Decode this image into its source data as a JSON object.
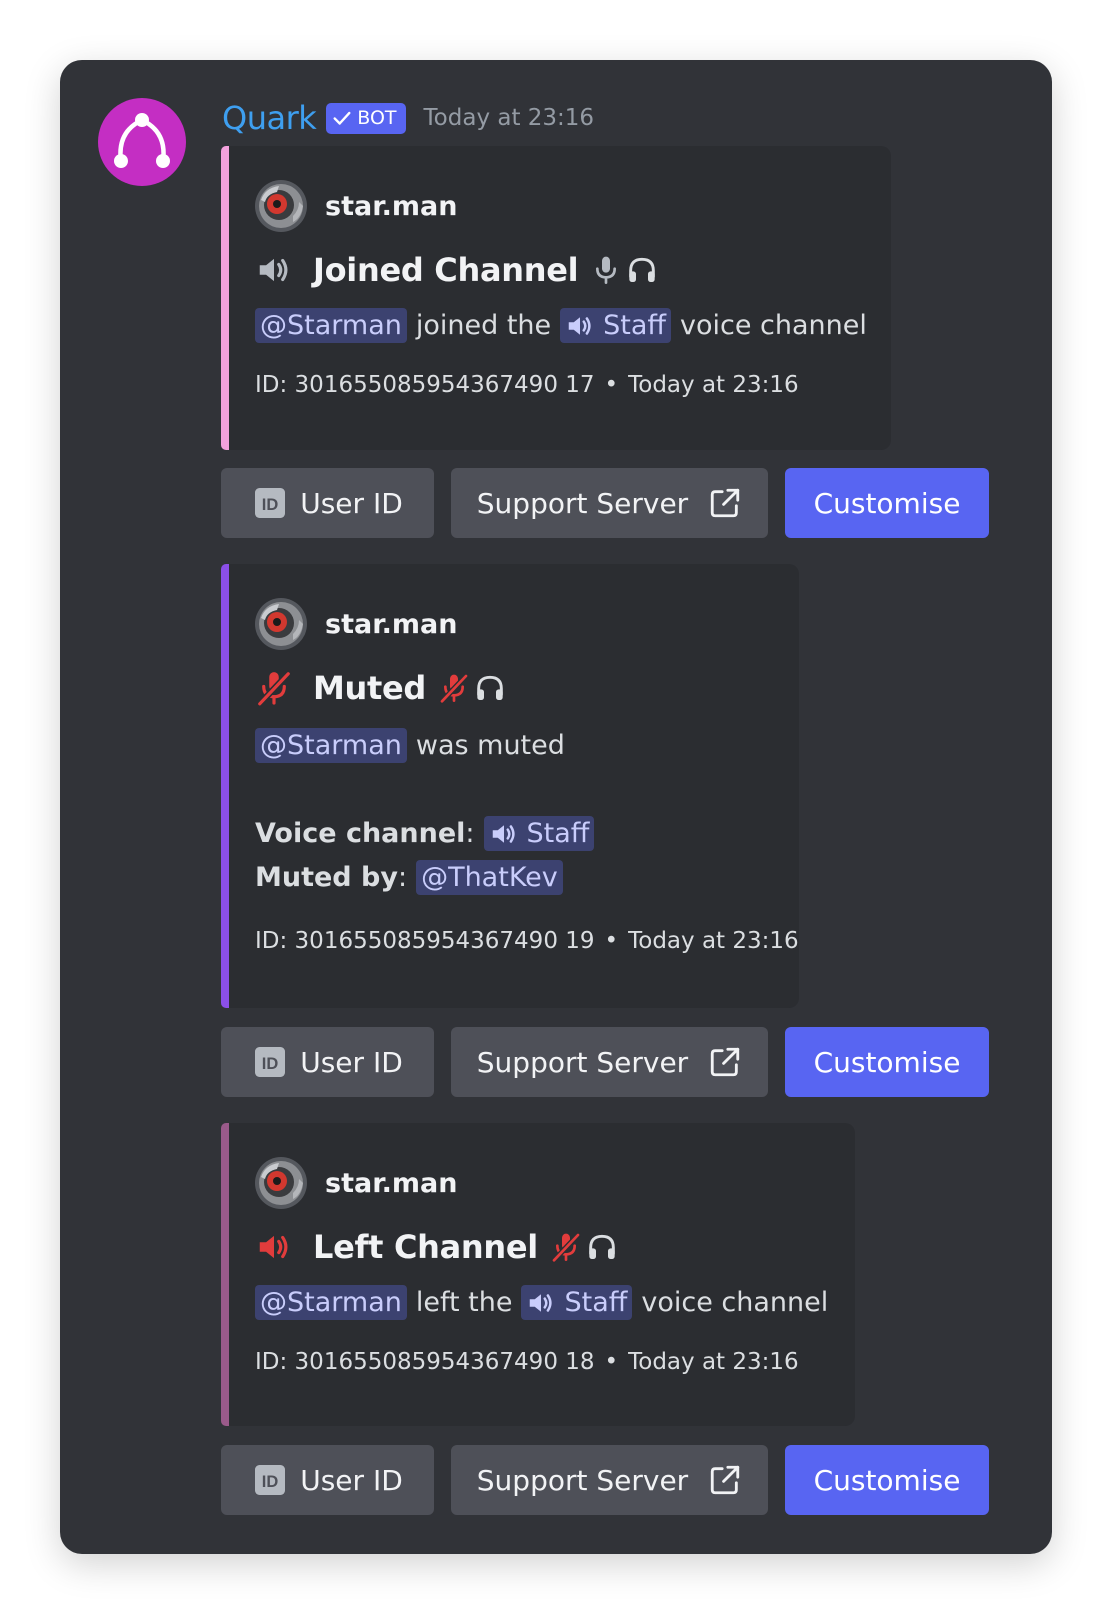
{
  "message": {
    "username": "Quark",
    "bot_tag": "BOT",
    "timestamp": "Today at 23:16",
    "avatar_icon": "quark-logo-icon",
    "colors": {
      "username": "#3e9ff0",
      "bot_tag": "#5865f2",
      "avatar": "#c42ec3"
    }
  },
  "embeds": [
    {
      "author": "star.man",
      "title": "Joined Channel",
      "lead_icon": "speaker-icon",
      "status_icons": [
        "microphone-icon",
        "headphones-icon"
      ],
      "user_mention": "@Starman",
      "text_1": "joined the",
      "channel_mention": "Staff",
      "text_2": "voice channel",
      "footer_id": "ID: 301655085954367490 17",
      "footer_dot": "•",
      "footer_time": "Today at 23:16",
      "accent": "#f3a1dd"
    },
    {
      "author": "star.man",
      "title": "Muted",
      "lead_icon": "muted-microphone-icon",
      "status_icons": [
        "muted-microphone-icon",
        "headphones-icon"
      ],
      "user_mention": "@Starman",
      "text_1": "was muted",
      "fields": [
        {
          "name": "Voice channel",
          "colon": ":",
          "value": "Staff"
        },
        {
          "name": "Muted by",
          "colon": ":",
          "value": "@ThatKev"
        }
      ],
      "footer_id": "ID: 301655085954367490 19",
      "footer_dot": "•",
      "footer_time": "Today at 23:16",
      "accent": "#8b4fe8"
    },
    {
      "author": "star.man",
      "title": "Left Channel",
      "lead_icon": "red-speaker-icon",
      "status_icons": [
        "muted-microphone-icon",
        "headphones-icon"
      ],
      "user_mention": "@Starman",
      "text_1": "left the",
      "channel_mention": "Staff",
      "text_2": "voice channel",
      "footer_id": "ID: 301655085954367490 18",
      "footer_dot": "•",
      "footer_time": "Today at 23:16",
      "accent": "#9a5a8a"
    }
  ],
  "buttons": {
    "user_id": "User ID",
    "support": "Support Server",
    "customise": "Customise"
  }
}
